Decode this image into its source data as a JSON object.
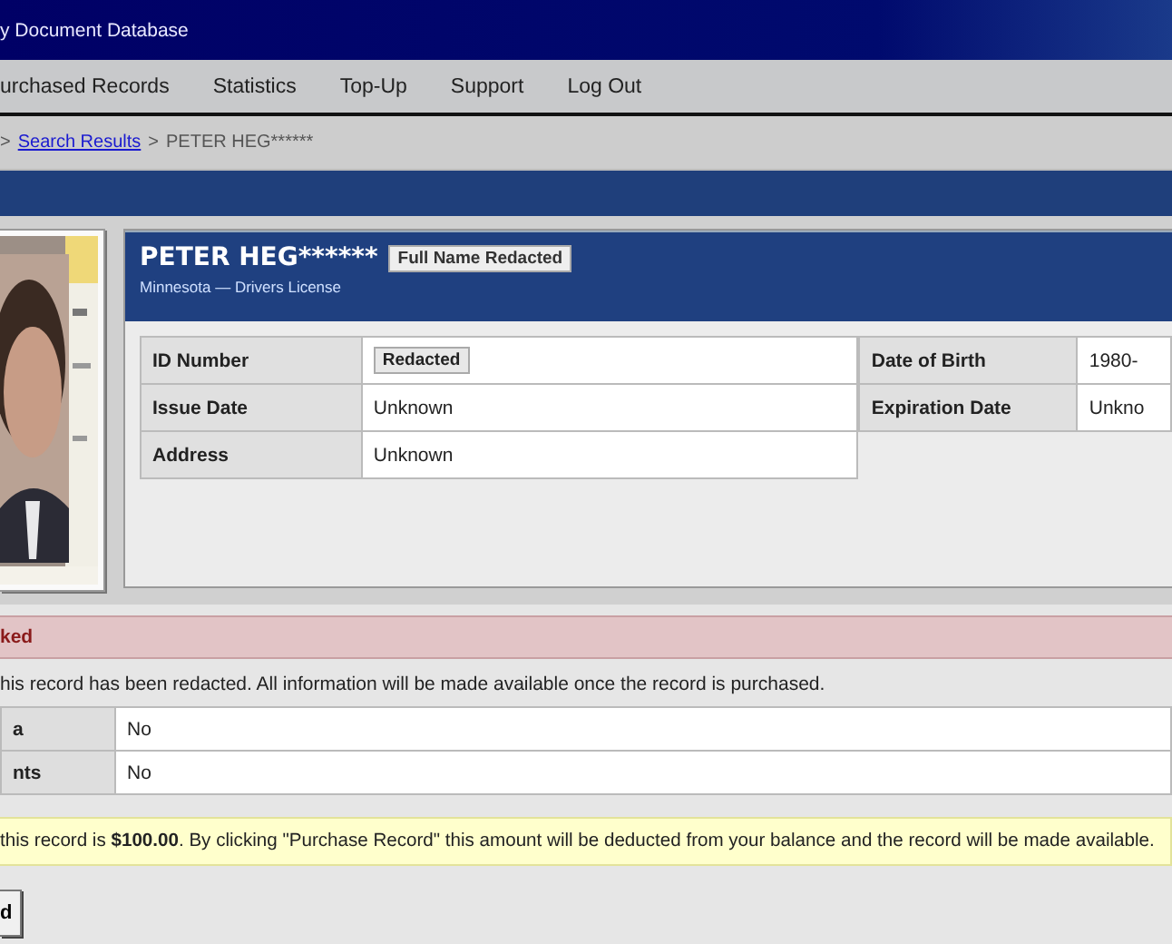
{
  "header": {
    "title": "y Document Database"
  },
  "nav": {
    "items": [
      "urchased Records",
      "Statistics",
      "Top-Up",
      "Support",
      "Log Out"
    ]
  },
  "breadcrumb": [
    {
      "text": ">",
      "kind": "separator"
    },
    {
      "text": "Search Results",
      "kind": "link"
    },
    {
      "text": ">",
      "kind": "separator"
    },
    {
      "text": "PETER HEG******",
      "kind": "current"
    }
  ],
  "record": {
    "name": "PETER HEG******",
    "badge": "Full Name Redacted",
    "subtitle": "Minnesota — Drivers License",
    "fields_left": [
      {
        "label": "ID Number",
        "value": "Redacted",
        "kind": "badge"
      },
      {
        "label": "Issue Date",
        "value": "Unknown",
        "kind": "text"
      },
      {
        "label": "Address",
        "value": "Unknown",
        "kind": "text"
      }
    ],
    "fields_right": [
      {
        "label": "Date of Birth",
        "value": "1980-"
      },
      {
        "label": "Expiration Date",
        "value": "Unkno"
      }
    ]
  },
  "locked_section": {
    "title": "ked",
    "notice": "his record has been redacted. All information will be made available once the record is purchased.",
    "rows": [
      {
        "label": "a",
        "value": "No"
      },
      {
        "label": "nts",
        "value": "No"
      }
    ]
  },
  "purchase": {
    "notice": "this record is **$100.00**. By clicking \"Purchase Record\" this amount will be deducted from your balance and the record will be made available.",
    "button": "d"
  }
}
